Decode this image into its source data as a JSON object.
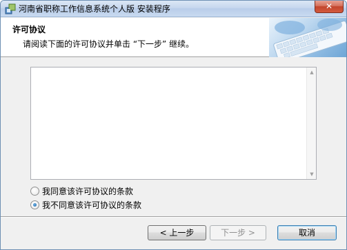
{
  "window": {
    "title": "河南省职称工作信息系统个人版 安装程序",
    "close_label": "✕"
  },
  "header": {
    "title": "许可协议",
    "subtitle": "请阅读下面的许可协议并单击 “下一步” 继续。"
  },
  "license": {
    "text": ""
  },
  "options": {
    "agree_label": "我同意该许可协议的条款",
    "disagree_label": "我不同意该许可协议的条款",
    "selected": "disagree"
  },
  "buttons": {
    "back_label": "< 上一步",
    "next_label": "下一步 >",
    "cancel_label": "取消"
  }
}
